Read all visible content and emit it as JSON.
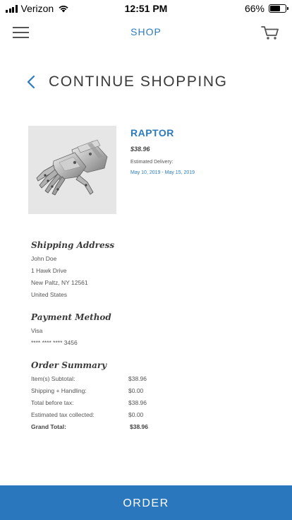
{
  "status_bar": {
    "carrier": "Verizon",
    "time": "12:51 PM",
    "battery_percent": "66%",
    "battery_level": 0.66
  },
  "nav": {
    "title": "SHOP",
    "menu_icon": "hamburger-menu-icon",
    "cart_icon": "shopping-cart-icon"
  },
  "continue_shopping": {
    "label": "CONTINUE SHOPPING",
    "icon": "chevron-left-icon"
  },
  "product": {
    "name": "RAPTOR",
    "price": "$38.96",
    "estimated_delivery_label": "Estimated Delivery:",
    "estimated_delivery_dates": "May 10, 2019 - May 15, 2019",
    "image": "robotic-hand-image"
  },
  "shipping": {
    "title": "Shipping Address",
    "lines": [
      "John Doe",
      "1 Hawk Drive",
      "New Paltz, NY 12561",
      "United States"
    ]
  },
  "payment": {
    "title": "Payment Method",
    "lines": [
      "Visa",
      "**** **** **** 3456"
    ]
  },
  "summary": {
    "title": "Order Summary",
    "rows": [
      {
        "label": "Item(s) Subtotal:",
        "value": "$38.96"
      },
      {
        "label": "Shipping + Handling:",
        "value": "$0.00"
      },
      {
        "label": "Total before tax:",
        "value": "$38.96"
      },
      {
        "label": "Estimated tax collected:",
        "value": "$0.00"
      },
      {
        "label": "Grand Total:",
        "value": "$38.96"
      }
    ]
  },
  "order_button": {
    "label": "ORDER"
  },
  "colors": {
    "accent": "#2b7bbf",
    "order_bg": "#2b77be",
    "image_bg": "#e6e6e6"
  }
}
